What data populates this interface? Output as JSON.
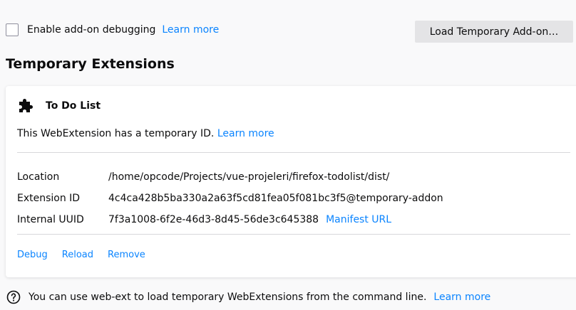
{
  "debugging": {
    "checkbox_checked": false,
    "label": "Enable add-on debugging",
    "learn_more": "Learn more"
  },
  "load_button": {
    "label": "Load Temporary Add-on…"
  },
  "section": {
    "title": "Temporary Extensions"
  },
  "extension": {
    "icon": "puzzle-piece-icon",
    "name": "To Do List",
    "temp_message": "This WebExtension has a temporary ID.",
    "temp_learn_more": "Learn more",
    "details": {
      "location_label": "Location",
      "location_value": "/home/opcode/Projects/vue-projeleri/firefox-todolist/dist/",
      "id_label": "Extension ID",
      "id_value": "4c4ca428b5ba330a2a63f5cd81fea05f081bc3f5@temporary-addon",
      "uuid_label": "Internal UUID",
      "uuid_value": "7f3a1008-6f2e-46d3-8d45-56de3c645388",
      "manifest_link": "Manifest URL"
    },
    "actions": {
      "debug": "Debug",
      "reload": "Reload",
      "remove": "Remove"
    }
  },
  "footer": {
    "icon": "info-icon",
    "text": "You can use web-ext to load temporary WebExtensions from the command line.",
    "learn_more": "Learn more"
  },
  "colors": {
    "link": "#0a84ff",
    "background": "#f9f9fa",
    "card": "#ffffff",
    "button": "#e4e4e6"
  }
}
